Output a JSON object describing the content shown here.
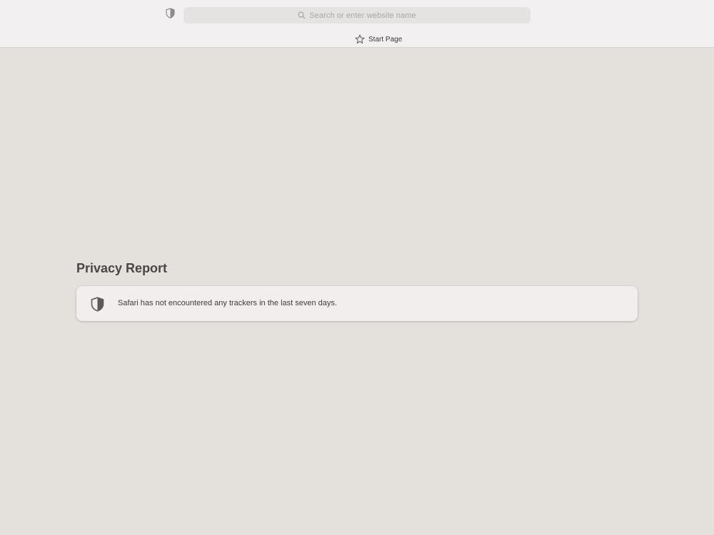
{
  "toolbar": {
    "privacy_icon": "shield-icon",
    "search": {
      "placeholder": "Search or enter website name",
      "icon": "search-icon"
    },
    "tab": {
      "icon": "star-icon",
      "label": "Start Page"
    }
  },
  "privacy_report": {
    "title": "Privacy Report",
    "icon": "shield-icon",
    "message": "Safari has not encountered any trackers in the last seven days."
  },
  "colors": {
    "page_background": "#e4e0dc",
    "toolbar_background": "#f2f0f0",
    "card_background": "#f2eeed"
  }
}
